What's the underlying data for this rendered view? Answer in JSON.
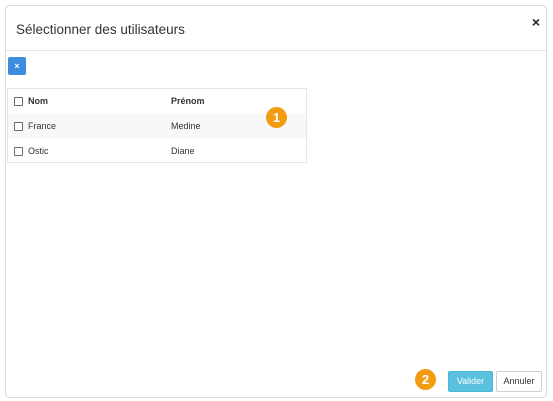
{
  "dialog": {
    "title": "Sélectionner des utilisateurs",
    "close_label": "×"
  },
  "toolbar": {
    "clear_label": "×"
  },
  "table": {
    "headers": {
      "nom": "Nom",
      "prenom": "Prénom"
    },
    "rows": [
      {
        "nom": "France",
        "prenom": "Medine"
      },
      {
        "nom": "Ostic",
        "prenom": "Diane"
      }
    ]
  },
  "badges": {
    "one": "1",
    "two": "2"
  },
  "footer": {
    "validate_label": "Valider",
    "cancel_label": "Annuler"
  },
  "colors": {
    "accent": "#5bc0de",
    "clear_button": "#3c8dde",
    "badge": "#f39c12"
  }
}
